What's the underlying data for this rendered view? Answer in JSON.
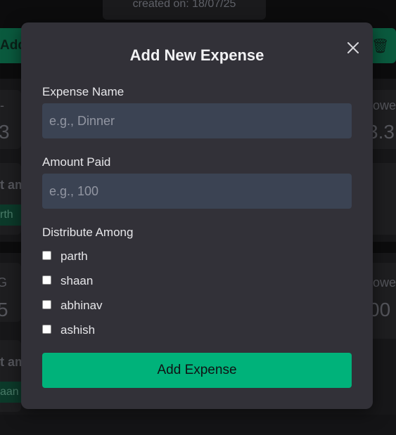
{
  "background": {
    "created_text": "created on: 18/07/25",
    "add_button_label": "Add expense",
    "card1": {
      "tile_left_label": "-",
      "tile_left_value": "3",
      "tile_right_label": "owe",
      "tile_right_value": "3.3",
      "split_label": "t am",
      "pill": "rth"
    },
    "card2": {
      "tile_left_label": "G",
      "tile_left_value": "5",
      "tile_right_label": "owe",
      "tile_right_value": "00",
      "split_label": "t am",
      "pill": "aan"
    }
  },
  "modal": {
    "title": "Add New Expense",
    "name_label": "Expense Name",
    "name_placeholder": "e.g., Dinner",
    "amount_label": "Amount Paid",
    "amount_placeholder": "e.g., 100",
    "distribute_label": "Distribute Among",
    "members": [
      "parth",
      "shaan",
      "abhinav",
      "ashish"
    ],
    "submit_label": "Add Expense"
  }
}
